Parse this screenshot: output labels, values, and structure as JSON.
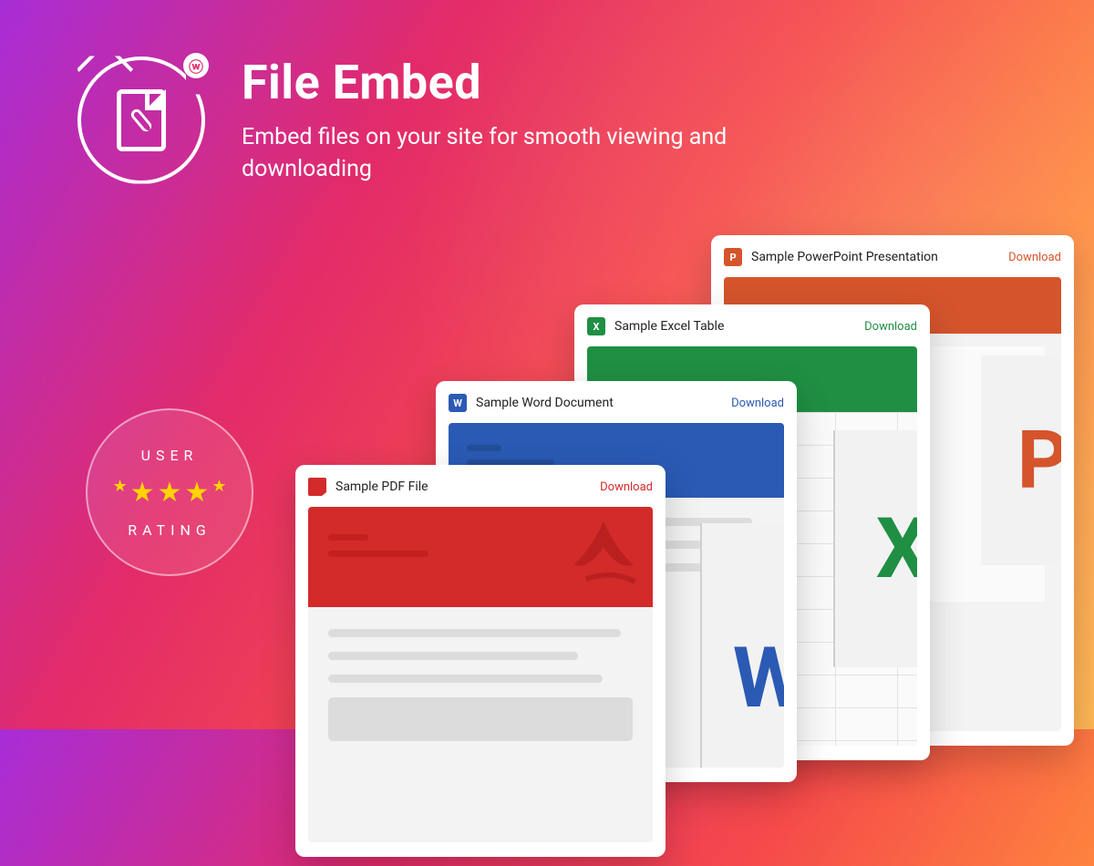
{
  "hero": {
    "title": "File Embed",
    "subtitle": "Embed files on your site for smooth viewing and downloading"
  },
  "rating": {
    "top_label": "USER",
    "bottom_label": "RATING",
    "stars": 5
  },
  "cards": {
    "pdf": {
      "title": "Sample PDF File",
      "action": "Download",
      "icon_letter": "",
      "color": "#d32a2a"
    },
    "word": {
      "title": "Sample Word Document",
      "action": "Download",
      "icon_letter": "W",
      "color": "#2a5ab4"
    },
    "excel": {
      "title": "Sample Excel Table",
      "action": "Download",
      "icon_letter": "X",
      "color": "#1f8f43"
    },
    "ppt": {
      "title": "Sample PowerPoint Presentation",
      "action": "Download",
      "icon_letter": "P",
      "color": "#d5542c"
    }
  },
  "big_letters": {
    "word": "W",
    "excel": "X",
    "ppt": "P"
  }
}
